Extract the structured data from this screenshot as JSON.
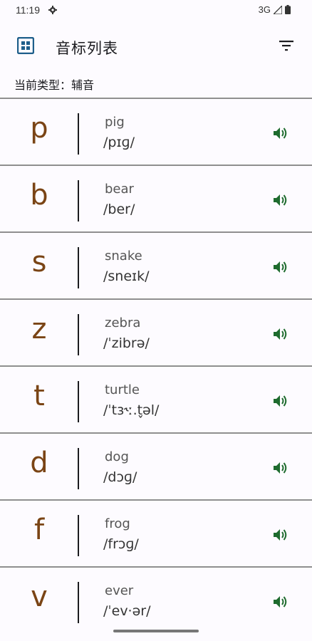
{
  "status": {
    "time": "11:19",
    "network": "3G"
  },
  "header": {
    "title": "音标列表"
  },
  "type_label": "当前类型：辅音",
  "items": [
    {
      "symbol": "p",
      "word": "pig",
      "ipa": "/pɪɡ/"
    },
    {
      "symbol": "b",
      "word": "bear",
      "ipa": "/ber/"
    },
    {
      "symbol": "s",
      "word": "snake",
      "ipa": "/sneɪk/"
    },
    {
      "symbol": "z",
      "word": "zebra",
      "ipa": "/ˈzibrə/"
    },
    {
      "symbol": "t",
      "word": "turtle",
      "ipa": "/ˈtɜ˞ː.t̬əl/"
    },
    {
      "symbol": "d",
      "word": "dog",
      "ipa": "/dɔɡ/"
    },
    {
      "symbol": "f",
      "word": "frog",
      "ipa": "/frɔɡ/"
    },
    {
      "symbol": "v",
      "word": "ever",
      "ipa": "/ˈev·ər/"
    }
  ],
  "colors": {
    "accent": "#1f5f8b",
    "letter": "#7a4415",
    "speaker": "#1e6b2e"
  },
  "icons": {
    "menu": "grid-icon",
    "filter": "filter-icon",
    "play": "speaker-icon"
  }
}
